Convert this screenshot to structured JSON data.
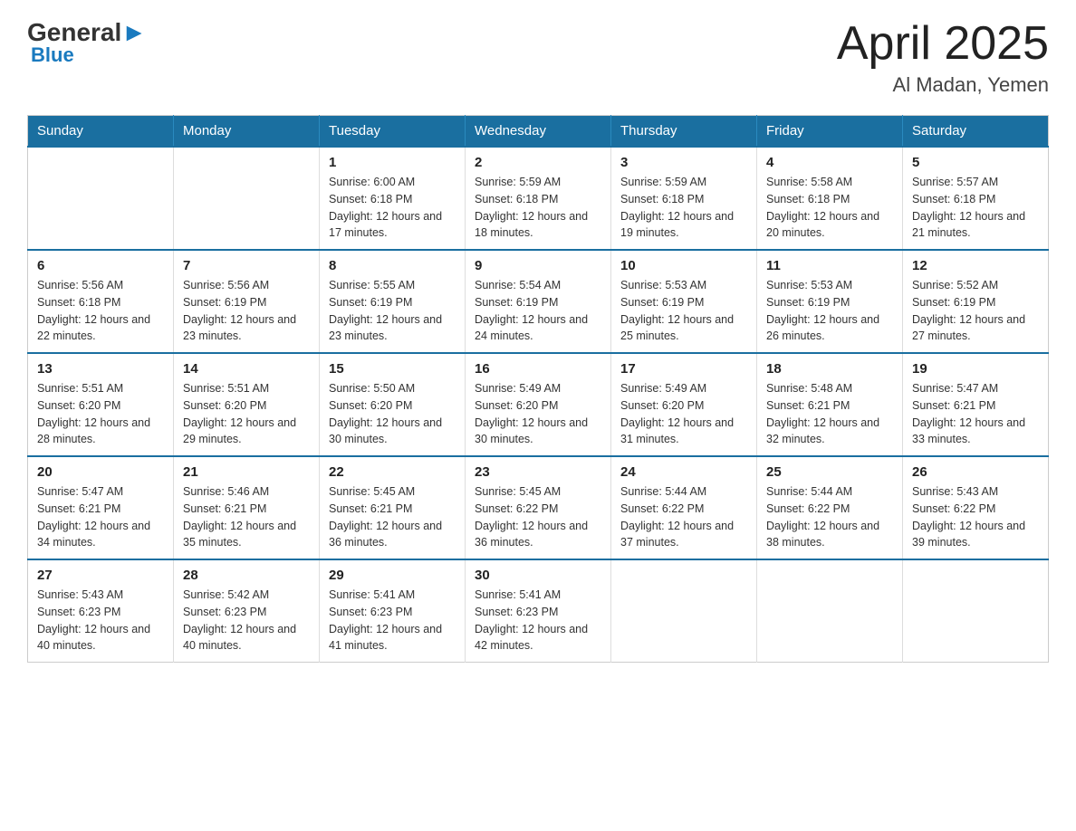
{
  "logo": {
    "general": "General",
    "blue": "Blue"
  },
  "header": {
    "month": "April 2025",
    "location": "Al Madan, Yemen"
  },
  "days_of_week": [
    "Sunday",
    "Monday",
    "Tuesday",
    "Wednesday",
    "Thursday",
    "Friday",
    "Saturday"
  ],
  "weeks": [
    [
      {
        "day": null
      },
      {
        "day": null
      },
      {
        "day": "1",
        "sunrise": "6:00 AM",
        "sunset": "6:18 PM",
        "daylight": "12 hours and 17 minutes."
      },
      {
        "day": "2",
        "sunrise": "5:59 AM",
        "sunset": "6:18 PM",
        "daylight": "12 hours and 18 minutes."
      },
      {
        "day": "3",
        "sunrise": "5:59 AM",
        "sunset": "6:18 PM",
        "daylight": "12 hours and 19 minutes."
      },
      {
        "day": "4",
        "sunrise": "5:58 AM",
        "sunset": "6:18 PM",
        "daylight": "12 hours and 20 minutes."
      },
      {
        "day": "5",
        "sunrise": "5:57 AM",
        "sunset": "6:18 PM",
        "daylight": "12 hours and 21 minutes."
      }
    ],
    [
      {
        "day": "6",
        "sunrise": "5:56 AM",
        "sunset": "6:18 PM",
        "daylight": "12 hours and 22 minutes."
      },
      {
        "day": "7",
        "sunrise": "5:56 AM",
        "sunset": "6:19 PM",
        "daylight": "12 hours and 23 minutes."
      },
      {
        "day": "8",
        "sunrise": "5:55 AM",
        "sunset": "6:19 PM",
        "daylight": "12 hours and 23 minutes."
      },
      {
        "day": "9",
        "sunrise": "5:54 AM",
        "sunset": "6:19 PM",
        "daylight": "12 hours and 24 minutes."
      },
      {
        "day": "10",
        "sunrise": "5:53 AM",
        "sunset": "6:19 PM",
        "daylight": "12 hours and 25 minutes."
      },
      {
        "day": "11",
        "sunrise": "5:53 AM",
        "sunset": "6:19 PM",
        "daylight": "12 hours and 26 minutes."
      },
      {
        "day": "12",
        "sunrise": "5:52 AM",
        "sunset": "6:19 PM",
        "daylight": "12 hours and 27 minutes."
      }
    ],
    [
      {
        "day": "13",
        "sunrise": "5:51 AM",
        "sunset": "6:20 PM",
        "daylight": "12 hours and 28 minutes."
      },
      {
        "day": "14",
        "sunrise": "5:51 AM",
        "sunset": "6:20 PM",
        "daylight": "12 hours and 29 minutes."
      },
      {
        "day": "15",
        "sunrise": "5:50 AM",
        "sunset": "6:20 PM",
        "daylight": "12 hours and 30 minutes."
      },
      {
        "day": "16",
        "sunrise": "5:49 AM",
        "sunset": "6:20 PM",
        "daylight": "12 hours and 30 minutes."
      },
      {
        "day": "17",
        "sunrise": "5:49 AM",
        "sunset": "6:20 PM",
        "daylight": "12 hours and 31 minutes."
      },
      {
        "day": "18",
        "sunrise": "5:48 AM",
        "sunset": "6:21 PM",
        "daylight": "12 hours and 32 minutes."
      },
      {
        "day": "19",
        "sunrise": "5:47 AM",
        "sunset": "6:21 PM",
        "daylight": "12 hours and 33 minutes."
      }
    ],
    [
      {
        "day": "20",
        "sunrise": "5:47 AM",
        "sunset": "6:21 PM",
        "daylight": "12 hours and 34 minutes."
      },
      {
        "day": "21",
        "sunrise": "5:46 AM",
        "sunset": "6:21 PM",
        "daylight": "12 hours and 35 minutes."
      },
      {
        "day": "22",
        "sunrise": "5:45 AM",
        "sunset": "6:21 PM",
        "daylight": "12 hours and 36 minutes."
      },
      {
        "day": "23",
        "sunrise": "5:45 AM",
        "sunset": "6:22 PM",
        "daylight": "12 hours and 36 minutes."
      },
      {
        "day": "24",
        "sunrise": "5:44 AM",
        "sunset": "6:22 PM",
        "daylight": "12 hours and 37 minutes."
      },
      {
        "day": "25",
        "sunrise": "5:44 AM",
        "sunset": "6:22 PM",
        "daylight": "12 hours and 38 minutes."
      },
      {
        "day": "26",
        "sunrise": "5:43 AM",
        "sunset": "6:22 PM",
        "daylight": "12 hours and 39 minutes."
      }
    ],
    [
      {
        "day": "27",
        "sunrise": "5:43 AM",
        "sunset": "6:23 PM",
        "daylight": "12 hours and 40 minutes."
      },
      {
        "day": "28",
        "sunrise": "5:42 AM",
        "sunset": "6:23 PM",
        "daylight": "12 hours and 40 minutes."
      },
      {
        "day": "29",
        "sunrise": "5:41 AM",
        "sunset": "6:23 PM",
        "daylight": "12 hours and 41 minutes."
      },
      {
        "day": "30",
        "sunrise": "5:41 AM",
        "sunset": "6:23 PM",
        "daylight": "12 hours and 42 minutes."
      },
      {
        "day": null
      },
      {
        "day": null
      },
      {
        "day": null
      }
    ]
  ]
}
